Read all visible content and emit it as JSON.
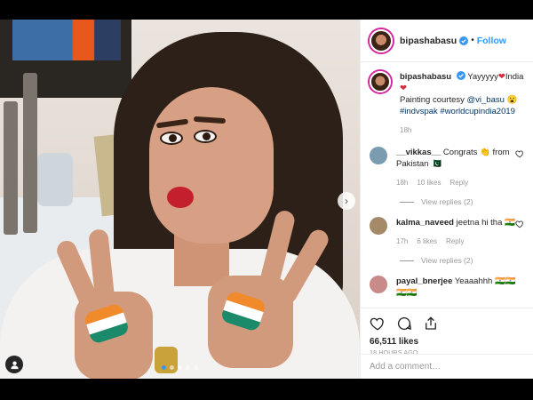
{
  "post": {
    "username": "bipashabasu",
    "follow_label": "Follow",
    "separator": "•",
    "caption_text": "Yayyyyy",
    "caption_emoji_heart": "❤",
    "caption_india": "India",
    "caption_line2": "Painting courtesy",
    "caption_mention": "@vi_basu",
    "caption_emoji_wow": "😮",
    "caption_tags": "#indvspak #worldcupindia2019",
    "caption_age": "18h",
    "likes": "66,511 likes",
    "posted_ago": "18 HOURS AGO",
    "add_comment_placeholder": "Add a comment…",
    "carousel_dots": 5,
    "carousel_active": 1
  },
  "comments": [
    {
      "username": "__vikkas__",
      "text": "Congrats",
      "emoji": "👏",
      "text2": "from Pakistan",
      "flag": "🇵🇰",
      "age": "18h",
      "likes": "10 likes",
      "reply": "Reply",
      "view_replies": "View replies (2)",
      "avatar_color": "#7a9bb0"
    },
    {
      "username": "kalma_naveed",
      "text": "jeetna hi tha",
      "emoji": "🇮🇳",
      "age": "17h",
      "likes": "6 likes",
      "reply": "Reply",
      "view_replies": "View replies (2)",
      "avatar_color": "#a58a6a"
    },
    {
      "username": "payal_bnerjee",
      "text": "Yeaaahhh",
      "emoji": "🇮🇳🇮🇳🇮🇳🇮🇳",
      "avatar_color": "#c98a8a"
    }
  ],
  "colors": {
    "accent": "#3897f0",
    "text": "#262626",
    "muted": "#999999",
    "hashtag": "#003569"
  },
  "icons": [
    "verified-badge-icon",
    "heart-icon",
    "comment-icon",
    "share-icon",
    "chevron-right-icon",
    "user-tag-icon"
  ]
}
